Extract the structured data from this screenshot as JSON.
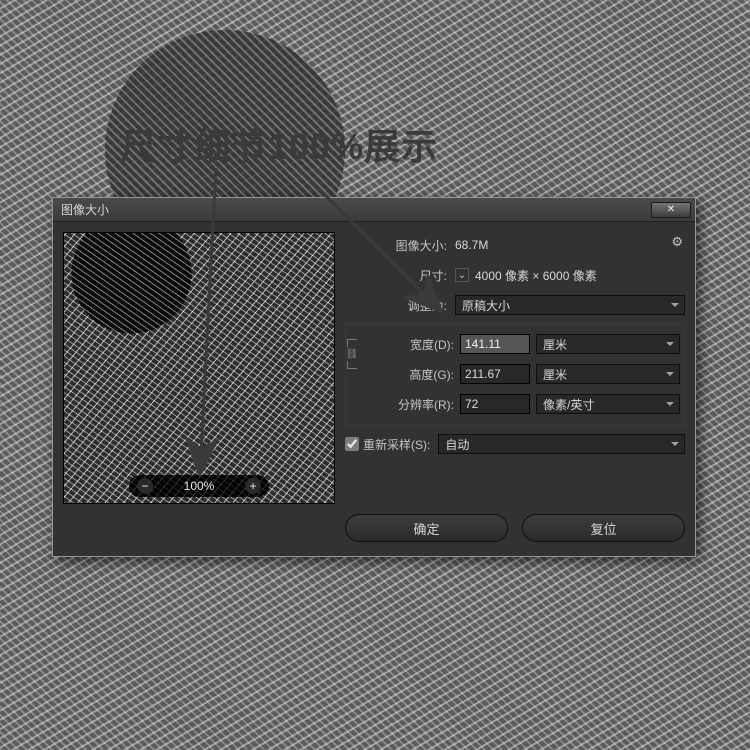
{
  "annotation": "尺寸细节100%展示",
  "dialog": {
    "title": "图像大小",
    "close_icon": "✕",
    "gear_icon": "⚙",
    "image_size_label": "图像大小:",
    "image_size_value": "68.7M",
    "dimensions_label": "尺寸:",
    "dimensions_value": "4000 像素 × 6000 像素",
    "fit_to_label": "调整为:",
    "fit_to_value": "原稿大小",
    "width_label": "宽度(D):",
    "width_value": "141.11",
    "width_unit": "厘米",
    "height_label": "高度(G):",
    "height_value": "211.67",
    "height_unit": "厘米",
    "resolution_label": "分辨率(R):",
    "resolution_value": "72",
    "resolution_unit": "像素/英寸",
    "resample_label": "重新采样(S):",
    "resample_value": "自动",
    "ok_label": "确定",
    "reset_label": "复位",
    "link_icon": "⛓"
  },
  "zoom": {
    "minus": "−",
    "value": "100%",
    "plus": "+"
  },
  "fit_checkbox_char": "✓"
}
